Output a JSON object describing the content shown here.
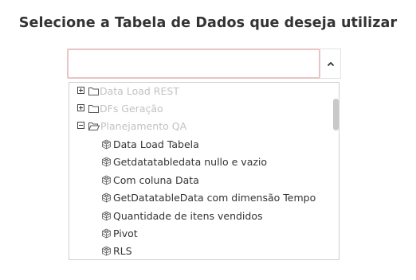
{
  "page": {
    "title": "Selecione a Tabela de Dados que deseja utilizar"
  },
  "select": {
    "value": "",
    "toggle_icon": "chevron-up-icon"
  },
  "tree": {
    "categories": [
      {
        "label": "Data Load REST",
        "expanded": false,
        "icon": "folder-icon"
      },
      {
        "label": "DFs Geração",
        "expanded": false,
        "icon": "folder-icon"
      },
      {
        "label": "Planejamento QA",
        "expanded": true,
        "icon": "folder-open-icon"
      }
    ],
    "items": [
      {
        "label": "Data Load Tabela",
        "icon": "cube-icon"
      },
      {
        "label": "Getdatatabledata nullo e vazio",
        "icon": "cube-icon"
      },
      {
        "label": "Com coluna Data",
        "icon": "cube-icon"
      },
      {
        "label": "GetDatatableData com dimensão Tempo",
        "icon": "cube-icon"
      },
      {
        "label": "Quantidade de itens vendidos",
        "icon": "cube-icon"
      },
      {
        "label": "Pivot",
        "icon": "cube-icon"
      },
      {
        "label": "RLS",
        "icon": "cube-icon"
      }
    ]
  },
  "colors": {
    "title": "#333333",
    "category_text": "#c2c2c2",
    "item_text": "#333333",
    "input_border": "#e8c4c4"
  }
}
